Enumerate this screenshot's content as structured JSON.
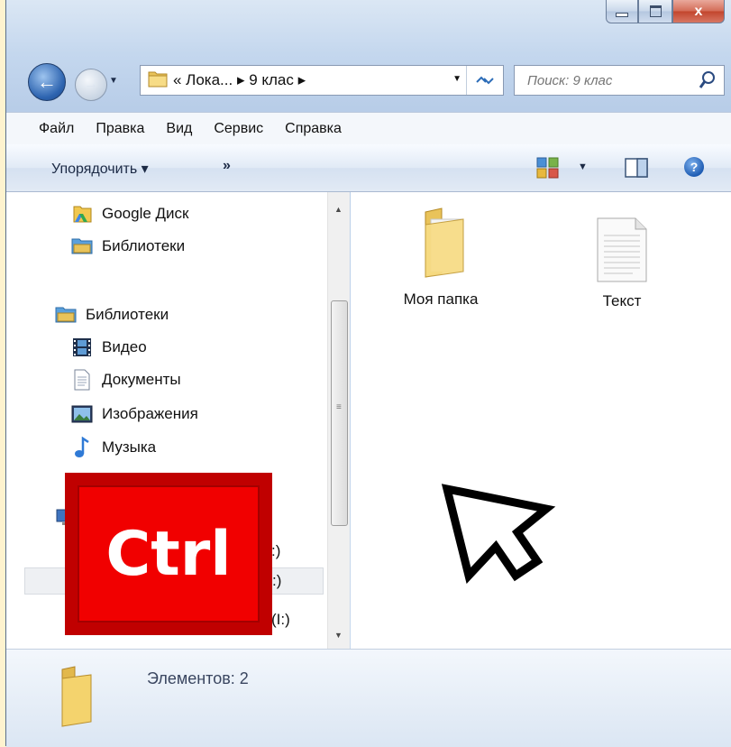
{
  "window": {
    "minimize_label": "Minimize",
    "maximize_label": "Maximize",
    "close_glyph": "x"
  },
  "address": {
    "path_text": "« Лока... ▸ 9 клас ▸",
    "refresh_glyph": "↶↷"
  },
  "search": {
    "placeholder": "Поиск: 9 клас"
  },
  "menu": {
    "items": [
      "Файл",
      "Правка",
      "Вид",
      "Сервис",
      "Справка"
    ]
  },
  "toolbar": {
    "organize_label": "Упорядочить ▾",
    "more_label": "»",
    "help_glyph": "?"
  },
  "navpane": {
    "items": [
      {
        "label": "Google Диск",
        "icon": "google-drive-icon"
      },
      {
        "label": "Библиотеки",
        "icon": "libraries-icon"
      },
      {
        "label": "Библиотеки",
        "icon": "libraries-icon"
      },
      {
        "label": "Видео",
        "icon": "video-icon"
      },
      {
        "label": "Документы",
        "icon": "documents-icon"
      },
      {
        "label": "Изображения",
        "icon": "pictures-icon"
      },
      {
        "label": "Музыка",
        "icon": "music-icon"
      }
    ],
    "drives": [
      {
        "label": ":)"
      },
      {
        "label": ":)"
      },
      {
        "label": "(I:)"
      }
    ]
  },
  "files": [
    {
      "name": "Моя папка",
      "icon": "folder-icon"
    },
    {
      "name": "Текст",
      "icon": "text-file-icon"
    }
  ],
  "status": {
    "text": "Элементов: 2"
  },
  "overlay": {
    "key_label": "Ctrl",
    "badge_color": "#f10000"
  }
}
